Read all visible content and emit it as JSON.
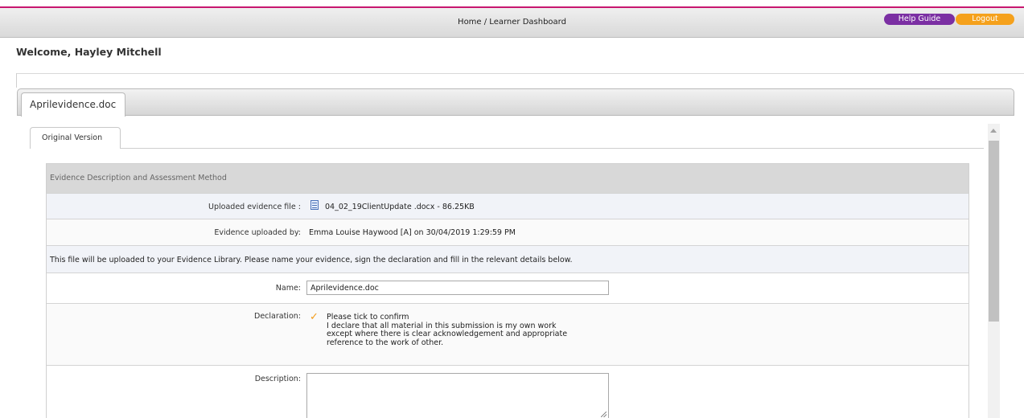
{
  "header": {
    "breadcrumb": "Home / Learner Dashboard",
    "help_label": "Help Guide",
    "logout_label": "Logout",
    "colors": {
      "accent": "#c8176f",
      "help": "#7b2fa3",
      "logout": "#f5a11c"
    }
  },
  "welcome": "Welcome, Hayley Mitchell",
  "outer_tab": {
    "label": "Aprilevidence.doc"
  },
  "inner_tab": {
    "label": "Original Version"
  },
  "form": {
    "section_title": "Evidence Description and Assessment Method",
    "uploaded_file": {
      "label": "Uploaded evidence file :",
      "icon": "document-icon",
      "value": "04_02_19ClientUpdate .docx - 86.25KB"
    },
    "uploaded_by": {
      "label": "Evidence uploaded by:",
      "value": "Emma Louise Haywood [A] on 30/04/2019 1:29:59 PM"
    },
    "info": "This file will be uploaded to your Evidence Library. Please name your evidence, sign the declaration and fill in the relevant details below.",
    "name": {
      "label": "Name:",
      "value": "Aprilevidence.doc"
    },
    "declaration": {
      "label": "Declaration:",
      "checked": true,
      "lines": [
        "Please tick to confirm",
        "I declare that all material in this submission is my own work",
        "except where there is clear acknowledgement and appropriate",
        "reference to the work of other."
      ]
    },
    "description": {
      "label": "Description:",
      "value": ""
    }
  }
}
